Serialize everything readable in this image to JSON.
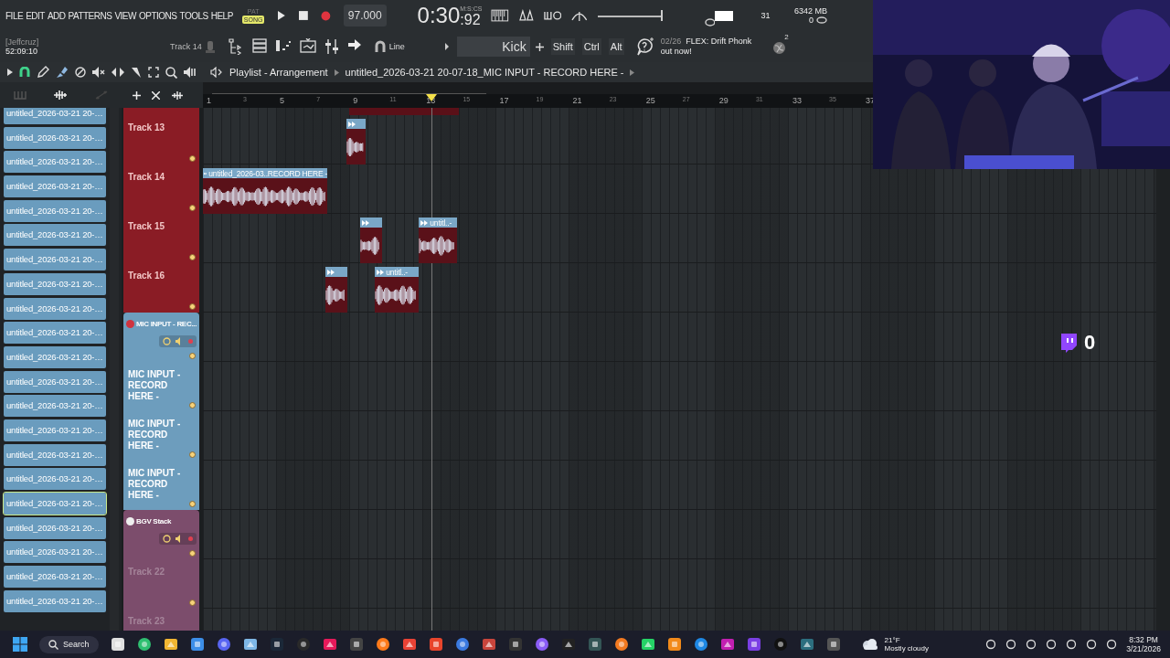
{
  "menu": [
    "FILE",
    "EDIT",
    "ADD",
    "PATTERNS",
    "VIEW",
    "OPTIONS",
    "TOOLS",
    "HELP"
  ],
  "mode_toggle": [
    {
      "label": "PAT",
      "selected": false
    },
    {
      "label": "SONG",
      "selected": true
    }
  ],
  "tempo": "97.000",
  "master_volume": {
    "level": 1.0
  },
  "time": {
    "main": "0:30",
    "centis": ":92",
    "unit": "M:S:CS"
  },
  "cpu": "31",
  "memory": "6342 MB",
  "polyphony": "0",
  "user": "[Jeffcruz]",
  "session_time": "52:09:10",
  "current_track": "Track 14",
  "snap": "Line",
  "pattern": "Kick",
  "modifiers": [
    "Shift",
    "Ctrl",
    "Alt"
  ],
  "news": {
    "date": "02/26",
    "message": "FLEX: Drift Phonk out now!"
  },
  "notifications": "2",
  "playlist": {
    "title": "Playlist - Arrangement",
    "path": "untitled_2026-03-21 20-07-18_MIC INPUT - RECORD HERE -",
    "ruler": [
      "1",
      "3",
      "5",
      "7",
      "9",
      "11",
      "13",
      "15",
      "17",
      "19",
      "21",
      "23",
      "25",
      "27",
      "29",
      "31",
      "33",
      "35",
      "37"
    ]
  },
  "clip_list": [
    {
      "label": "untitled_2026-03-21 20-…",
      "selected": false
    },
    {
      "label": "untitled_2026-03-21 20-…",
      "selected": false
    },
    {
      "label": "untitled_2026-03-21 20-…",
      "selected": false
    },
    {
      "label": "untitled_2026-03-21 20-…",
      "selected": false
    },
    {
      "label": "untitled_2026-03-21 20-…",
      "selected": false
    },
    {
      "label": "untitled_2026-03-21 20-…",
      "selected": false
    },
    {
      "label": "untitled_2026-03-21 20-…",
      "selected": false
    },
    {
      "label": "untitled_2026-03-21 20-…",
      "selected": false
    },
    {
      "label": "untitled_2026-03-21 20-…",
      "selected": false
    },
    {
      "label": "untitled_2026-03-21 20-…",
      "selected": false
    },
    {
      "label": "untitled_2026-03-21 20-…",
      "selected": false
    },
    {
      "label": "untitled_2026-03-21 20-…",
      "selected": false
    },
    {
      "label": "untitled_2026-03-21 20-…",
      "selected": false
    },
    {
      "label": "untitled_2026-03-21 20-…",
      "selected": false
    },
    {
      "label": "untitled_2026-03-21 20-…",
      "selected": false
    },
    {
      "label": "untitled_2026-03-21 20-…",
      "selected": false
    },
    {
      "label": "untitled_2026-03-21 20-…",
      "selected": true
    },
    {
      "label": "untitled_2026-03-21 20-…",
      "selected": false
    },
    {
      "label": "untitled_2026-03-21 20-…",
      "selected": false
    },
    {
      "label": "untitled_2026-03-21 20-…",
      "selected": false
    },
    {
      "label": "untitled_2026-03-21 20-…",
      "selected": false
    }
  ],
  "tracks": [
    {
      "kind": "track",
      "name": "Track 13",
      "color": "#8a1c25",
      "enabled": true,
      "clips": [
        {
          "kind": "audio"
        }
      ]
    },
    {
      "kind": "track",
      "name": "Track 14",
      "color": "#8a1c25",
      "enabled": true,
      "clips": [
        {
          "kind": "audio",
          "label": "untitled_2026-03..RECORD HERE -"
        }
      ]
    },
    {
      "kind": "track",
      "name": "Track 15",
      "color": "#8a1c25",
      "enabled": true,
      "clips": [
        {
          "kind": "audio"
        },
        {
          "kind": "audio",
          "label": "untitl..-"
        }
      ]
    },
    {
      "kind": "track",
      "name": "Track 16",
      "color": "#8a1c25",
      "enabled": true,
      "clips": [
        {
          "kind": "audio"
        },
        {
          "kind": "audio",
          "label": "untitl..-"
        }
      ]
    },
    {
      "kind": "group",
      "name": "MIC INPUT - REC...",
      "color": "#6d9dbd"
    },
    {
      "kind": "track",
      "name": "MIC INPUT - RECORD HERE -",
      "color": "#6d9dbd",
      "enabled": true
    },
    {
      "kind": "track",
      "name": "MIC INPUT - RECORD HERE -",
      "color": "#6d9dbd",
      "enabled": true
    },
    {
      "kind": "track",
      "name": "MIC INPUT - RECORD HERE -",
      "color": "#6d9dbd",
      "enabled": true
    },
    {
      "kind": "group",
      "name": "BGV Stack",
      "color": "#7c4d6c"
    },
    {
      "kind": "track",
      "name": "Track 22",
      "color": "#7c4d6c",
      "enabled": false
    },
    {
      "kind": "track",
      "name": "Track 23",
      "color": "#7c4d6c",
      "enabled": false
    }
  ],
  "viewers": "0",
  "taskbar": {
    "search": "Search",
    "weather_temp": "21°F",
    "weather_text": "Mostly cloudy",
    "time": "8:32 PM",
    "date": "3/21/2026"
  }
}
